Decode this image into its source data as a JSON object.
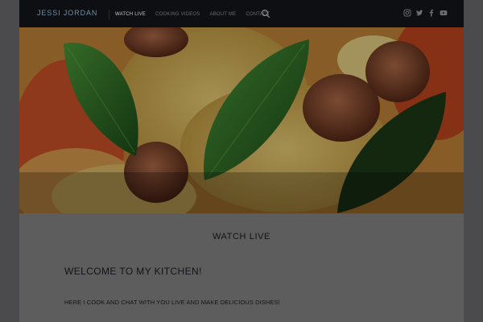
{
  "site": {
    "brand": "JESSI JORDAN"
  },
  "nav": {
    "items": [
      {
        "label": "WATCH LIVE",
        "active": true
      },
      {
        "label": "COOKING VIDEOS",
        "active": false
      },
      {
        "label": "ABOUT ME",
        "active": false
      },
      {
        "label": "CONTACT",
        "active": false
      }
    ],
    "search_icon": "search-icon",
    "social_icons": [
      "instagram-icon",
      "twitter-icon",
      "facebook-icon",
      "youtube-icon"
    ]
  },
  "hero": {
    "image": "pizza with basil leaves and sausage"
  },
  "main": {
    "section_title": "WATCH LIVE",
    "heading": "WELCOME TO MY KITCHEN!",
    "intro": "HERE I COOK AND CHAT WITH YOU LIVE AND MAKE DELICIOUS DISHES!"
  },
  "colors": {
    "navbar": "#0e0f12",
    "brand_text": "#6f8fa8",
    "nav_active": "#c9cacd",
    "nav_inactive": "#6a6c72",
    "page_bg": "#5d5d5e"
  }
}
